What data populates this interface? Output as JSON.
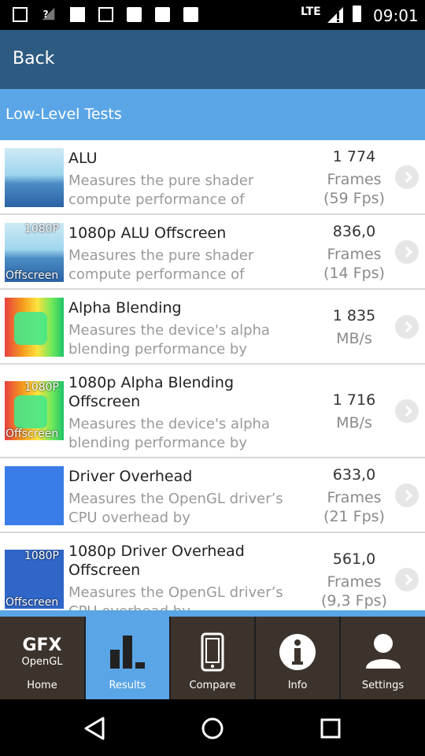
{
  "status": {
    "network": "LTE",
    "time": "09:01"
  },
  "header": {
    "back_label": "Back"
  },
  "section": {
    "title": "Low-Level Tests"
  },
  "tests": [
    {
      "thumb_icon": "alu-thumbnail",
      "title": "ALU",
      "description": "Measures the pure shader compute performance of",
      "value": "1 774",
      "unit": "Frames",
      "fps": "(59 Fps)"
    },
    {
      "thumb_icon": "alu-offscreen-thumbnail",
      "thumb_top": "1080P",
      "thumb_bottom": "Offscreen",
      "title": "1080p ALU Offscreen",
      "description": "Measures the pure shader compute performance of",
      "value": "836,0",
      "unit": "Frames",
      "fps": "(14 Fps)"
    },
    {
      "thumb_icon": "alpha-blending-thumbnail",
      "title": "Alpha Blending",
      "description": "Measures the device's alpha blending performance by",
      "value": "1 835",
      "unit": "MB/s"
    },
    {
      "thumb_icon": "alpha-blending-offscreen-thumbnail",
      "thumb_top": "1080P",
      "thumb_bottom": "Offscreen",
      "title": "1080p Alpha Blending Offscreen",
      "description": "Measures the device's alpha blending performance by",
      "value": "1 716",
      "unit": "MB/s"
    },
    {
      "thumb_icon": "driver-overhead-thumbnail",
      "title": "Driver Overhead",
      "description": "Measures the OpenGL driver’s CPU overhead by",
      "value": "633,0",
      "unit": "Frames",
      "fps": "(21 Fps)"
    },
    {
      "thumb_icon": "driver-overhead-offscreen-thumbnail",
      "thumb_top": "1080P",
      "thumb_bottom": "Offscreen",
      "title": "1080p Driver Overhead Offscreen",
      "description": "Measures the OpenGL driver’s CPU overhead by",
      "value": "561,0",
      "unit": "Frames",
      "fps": "(9,3 Fps)"
    }
  ],
  "tabs": [
    {
      "label": "Home",
      "logo": "GFX",
      "logo_sub": "OpenGL",
      "icon": "gfx-logo-icon",
      "active": false
    },
    {
      "label": "Results",
      "icon": "bar-chart-icon",
      "active": true
    },
    {
      "label": "Compare",
      "icon": "phone-icon",
      "active": false
    },
    {
      "label": "Info",
      "icon": "info-icon",
      "active": false
    },
    {
      "label": "Settings",
      "icon": "user-icon",
      "active": false
    }
  ],
  "colors": {
    "header": "#2d5a80",
    "section": "#5aa5e6",
    "tab_active": "#5aa5e6",
    "tab_inactive": "#3c332c"
  }
}
